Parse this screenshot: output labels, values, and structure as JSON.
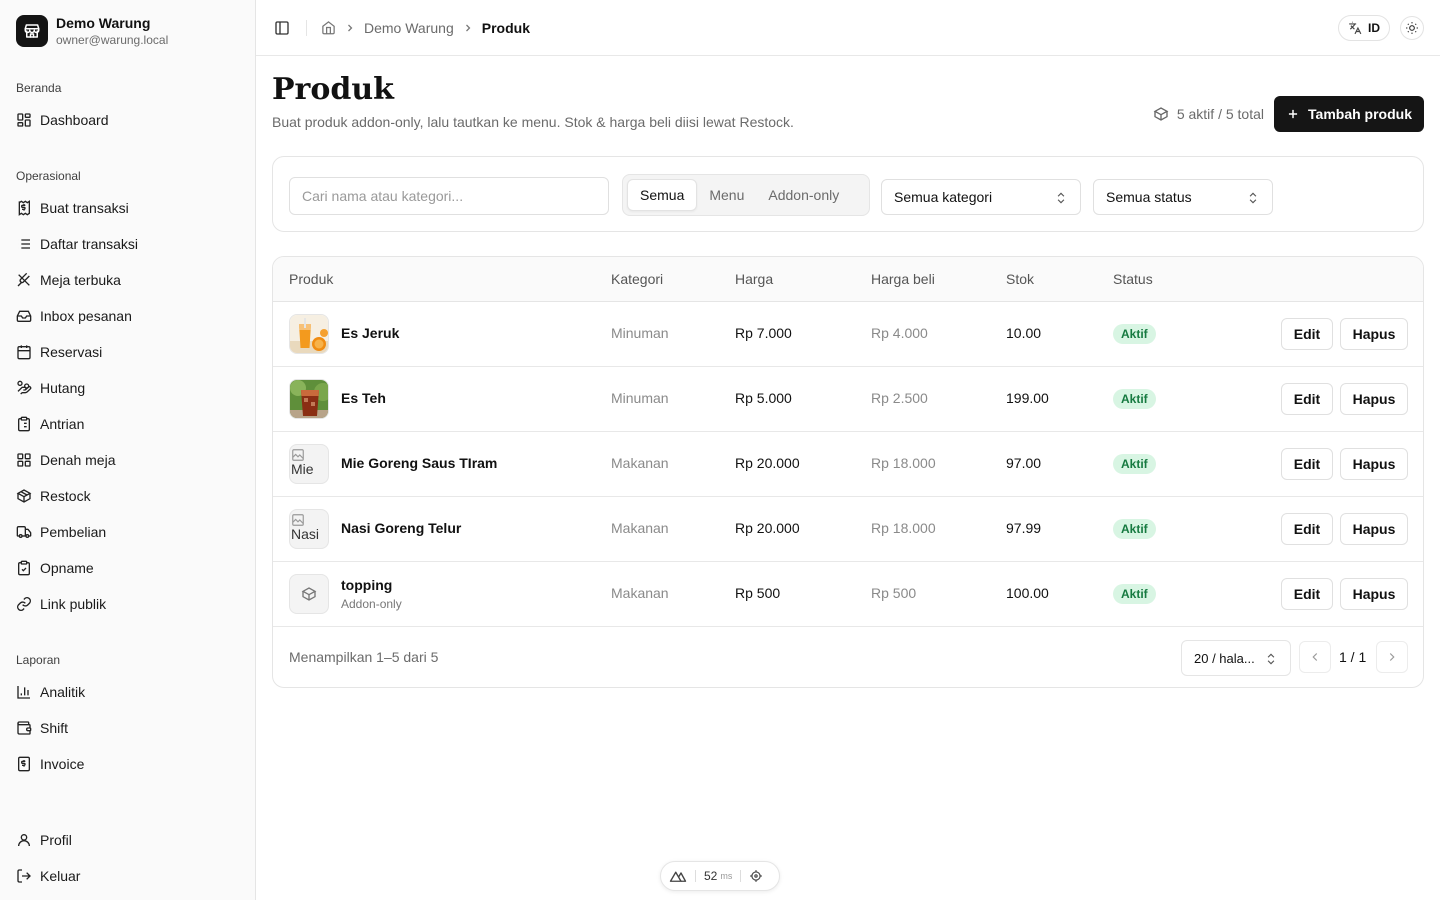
{
  "brand": {
    "name": "Demo Warung",
    "email": "owner@warung.local"
  },
  "nav": {
    "beranda": {
      "label": "Beranda",
      "items": [
        {
          "label": "Dashboard",
          "icon": "dashboard-icon"
        }
      ]
    },
    "operasional": {
      "label": "Operasional",
      "items": [
        {
          "label": "Buat transaksi",
          "icon": "receipt-icon"
        },
        {
          "label": "Daftar transaksi",
          "icon": "list-icon"
        },
        {
          "label": "Meja terbuka",
          "icon": "utensils-icon"
        },
        {
          "label": "Inbox pesanan",
          "icon": "inbox-icon"
        },
        {
          "label": "Reservasi",
          "icon": "calendar-icon"
        },
        {
          "label": "Hutang",
          "icon": "hand-coins-icon"
        },
        {
          "label": "Antrian",
          "icon": "clipboard-list-icon"
        },
        {
          "label": "Denah meja",
          "icon": "layout-grid-icon"
        },
        {
          "label": "Restock",
          "icon": "package-icon"
        },
        {
          "label": "Pembelian",
          "icon": "truck-icon"
        },
        {
          "label": "Opname",
          "icon": "clipboard-check-icon"
        },
        {
          "label": "Link publik",
          "icon": "link-icon"
        }
      ]
    },
    "laporan": {
      "label": "Laporan",
      "items": [
        {
          "label": "Analitik",
          "icon": "bar-chart-icon"
        },
        {
          "label": "Shift",
          "icon": "wallet-icon"
        },
        {
          "label": "Invoice",
          "icon": "invoice-icon"
        }
      ]
    },
    "bottom": [
      {
        "label": "Profil",
        "icon": "user-icon"
      },
      {
        "label": "Keluar",
        "icon": "logout-icon"
      }
    ]
  },
  "header": {
    "breadcrumb": [
      "Demo Warung",
      "Produk"
    ],
    "lang": "ID"
  },
  "page": {
    "title": "Produk",
    "subtitle": "Buat produk addon-only, lalu tautkan ke menu. Stok & harga beli diisi lewat Restock.",
    "count": "5 aktif / 5 total",
    "add_label": "Tambah produk"
  },
  "filters": {
    "search_placeholder": "Cari nama atau kategori...",
    "segments": [
      "Semua",
      "Menu",
      "Addon-only"
    ],
    "active_segment": "Semua",
    "category": "Semua kategori",
    "status": "Semua status"
  },
  "table": {
    "headers": [
      "Produk",
      "Kategori",
      "Harga",
      "Harga beli",
      "Stok",
      "Status"
    ],
    "rows": [
      {
        "name": "Es Jeruk",
        "sub": "",
        "thumb": "orange-drink-image",
        "category": "Minuman",
        "price": "Rp 7.000",
        "buy_price": "Rp 4.000",
        "stock": "10.00",
        "status": "Aktif"
      },
      {
        "name": "Es Teh",
        "sub": "",
        "thumb": "iced-tea-image",
        "category": "Minuman",
        "price": "Rp 5.000",
        "buy_price": "Rp 2.500",
        "stock": "199.00",
        "status": "Aktif"
      },
      {
        "name": "Mie Goreng Saus TIram",
        "sub": "",
        "thumb_alt": "Mie",
        "category": "Makanan",
        "price": "Rp 20.000",
        "buy_price": "Rp 18.000",
        "stock": "97.00",
        "status": "Aktif"
      },
      {
        "name": "Nasi Goreng Telur",
        "sub": "",
        "thumb_alt": "Nasi",
        "category": "Makanan",
        "price": "Rp 20.000",
        "buy_price": "Rp 18.000",
        "stock": "97.99",
        "status": "Aktif"
      },
      {
        "name": "topping",
        "sub": "Addon-only",
        "thumb": "package-icon",
        "category": "Makanan",
        "price": "Rp 500",
        "buy_price": "Rp 500",
        "stock": "100.00",
        "status": "Aktif"
      }
    ],
    "edit_label": "Edit",
    "delete_label": "Hapus",
    "footer": "Menampilkan 1–5 dari 5",
    "page_size": "20 / hala...",
    "page": "1 / 1"
  },
  "dev": {
    "ms": "52",
    "unit": "ms"
  },
  "colors": {
    "primary": "#151515",
    "badge_bg": "#d8f5e3",
    "badge_text": "#167a40"
  }
}
